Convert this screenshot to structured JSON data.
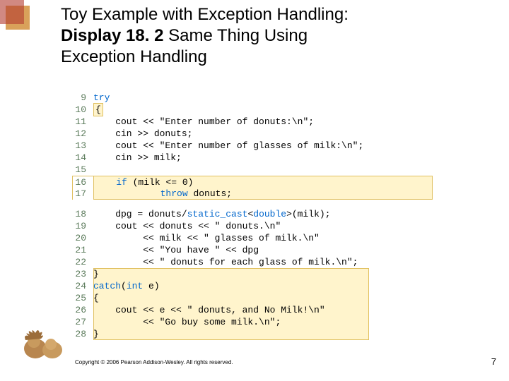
{
  "title": {
    "line1_plain": "Toy Example with Exception Handling:",
    "line2_bold": "Display 18. 2 ",
    "line2_plain": " Same Thing Using",
    "line3_plain": "Exception Handling"
  },
  "code": {
    "lines": [
      {
        "n": "9",
        "pre": "",
        "kw": "try",
        "post": ""
      },
      {
        "n": "10",
        "text": "{",
        "hlshort": true
      },
      {
        "n": "11",
        "text": "    cout << \"Enter number of donuts:\\n\";"
      },
      {
        "n": "12",
        "text": "    cin >> donuts;"
      },
      {
        "n": "13",
        "text": "    cout << \"Enter number of glasses of milk:\\n\";"
      },
      {
        "n": "14",
        "text": "    cin >> milk;"
      },
      {
        "n": "15",
        "text": ""
      },
      {
        "n": "16",
        "boxed": true,
        "pre": "    ",
        "kw": "if",
        "mid": " (milk <= 0)",
        "post": ""
      },
      {
        "n": "17",
        "boxed": true,
        "pre": "            ",
        "kw": "throw",
        "mid": " donuts;",
        "post": ""
      }
    ],
    "lines2": [
      {
        "n": "18",
        "text_a": "    dpg = donuts/",
        "kw": "static_cast",
        "text_b": "<",
        "kw2": "double",
        "text_c": ">(milk);"
      },
      {
        "n": "19",
        "text": "    cout << donuts << \" donuts.\\n\""
      },
      {
        "n": "20",
        "text": "         << milk << \" glasses of milk.\\n\""
      },
      {
        "n": "21",
        "text": "         << \"You have \" << dpg"
      },
      {
        "n": "22",
        "text": "         << \" donuts for each glass of milk.\\n\";"
      },
      {
        "n": "23",
        "text": "}",
        "bg": true
      },
      {
        "n": "24",
        "pre": "",
        "kw": "catch",
        "mid": "(",
        "kw2": "int",
        "post": " e)",
        "bg": true
      },
      {
        "n": "25",
        "text": "{",
        "bg": true
      },
      {
        "n": "26",
        "text": "    cout << e << \" donuts, and No Milk!\\n\"",
        "bg": true
      },
      {
        "n": "27",
        "text": "         << \"Go buy some milk.\\n\";",
        "bg": true
      },
      {
        "n": "28",
        "text": "}",
        "bg": true
      }
    ]
  },
  "copyright": "Copyright © 2006 Pearson Addison-Wesley. All rights reserved.",
  "page": "7"
}
